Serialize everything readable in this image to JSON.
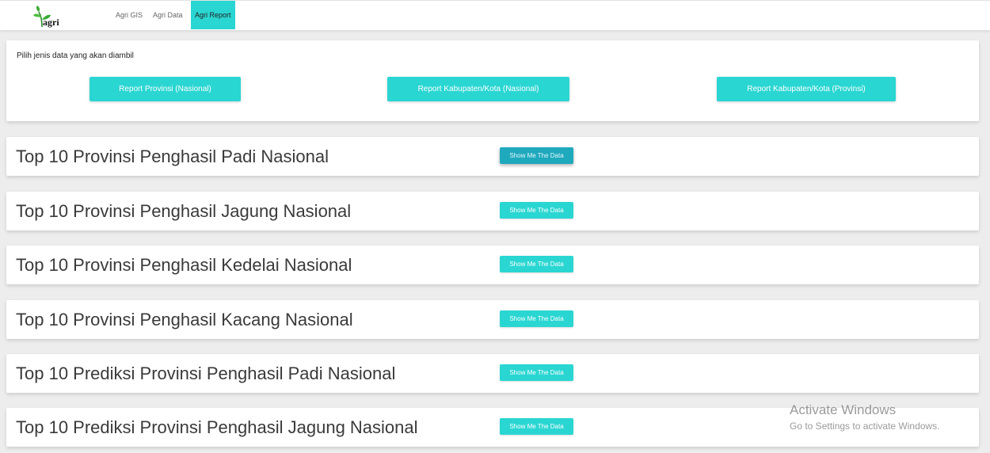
{
  "navbar": {
    "logo_text": "agri",
    "items": [
      {
        "label": "Agri GIS",
        "active": false
      },
      {
        "label": "Agri Data",
        "active": false
      },
      {
        "label": "Agri Report",
        "active": true
      }
    ]
  },
  "selector": {
    "label": "Pilih jenis data yang akan diambil",
    "buttons": [
      {
        "label": "Report Provinsi (Nasional)"
      },
      {
        "label": "Report Kabupaten/Kota (Nasional)"
      },
      {
        "label": "Report Kabupaten/Kota (Provinsi)"
      }
    ]
  },
  "cards": [
    {
      "title": "Top 10 Provinsi Penghasil Padi Nasional",
      "button": "Show Me The Data",
      "hover": true
    },
    {
      "title": "Top 10 Provinsi Penghasil Jagung Nasional",
      "button": "Show Me The Data",
      "hover": false
    },
    {
      "title": "Top 10 Provinsi Penghasil Kedelai Nasional",
      "button": "Show Me The Data",
      "hover": false
    },
    {
      "title": "Top 10 Provinsi Penghasil Kacang Nasional",
      "button": "Show Me The Data",
      "hover": false
    },
    {
      "title": "Top 10 Prediksi Provinsi Penghasil Padi Nasional",
      "button": "Show Me The Data",
      "hover": false
    },
    {
      "title": "Top 10 Prediksi Provinsi Penghasil Jagung Nasional",
      "button": "Show Me The Data",
      "hover": false
    }
  ],
  "watermark": {
    "title": "Activate Windows",
    "subtitle": "Go to Settings to activate Windows."
  },
  "icons": {
    "logo": "leaf-sprout-icon"
  },
  "colors": {
    "accent": "#2ad6d2",
    "accent_hover": "#1fa9bd",
    "logo_green": "#3aaa35",
    "background": "#ededed"
  }
}
